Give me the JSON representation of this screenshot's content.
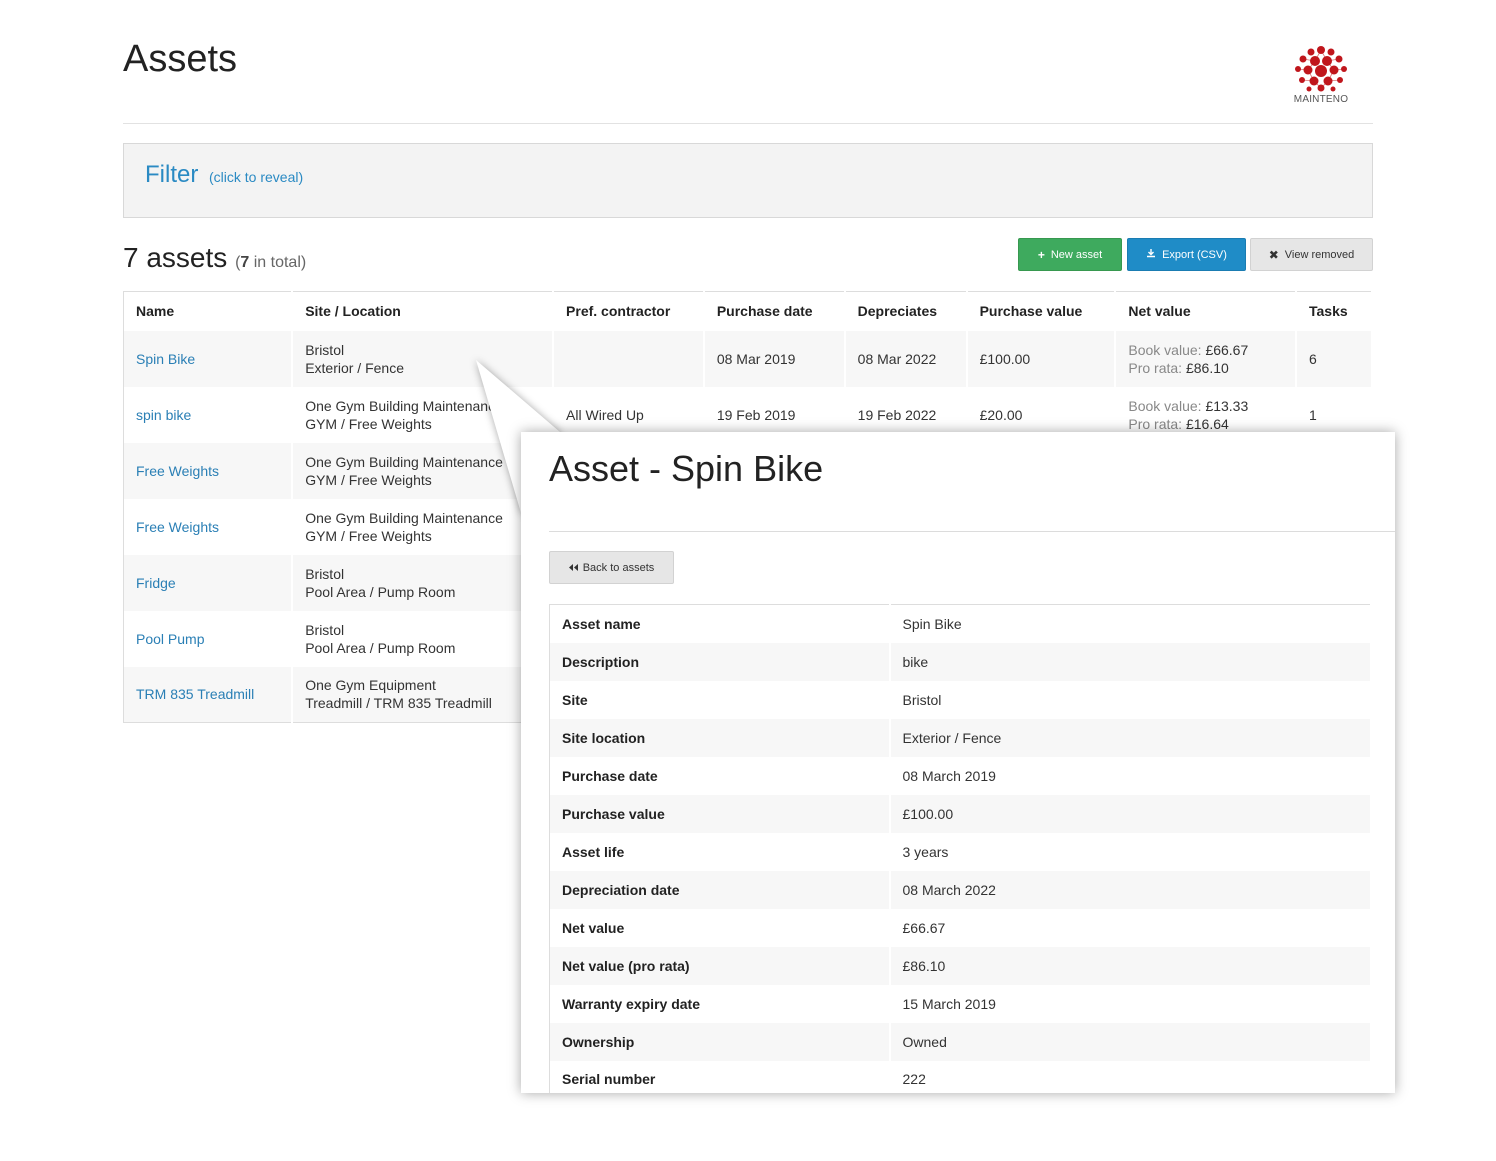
{
  "header": {
    "title": "Assets",
    "logo_text": "MAINTENO"
  },
  "filter": {
    "title": "Filter",
    "hint": "(click to reveal)"
  },
  "summary": {
    "count_label": "7 assets",
    "total_open": "(",
    "total_num": "7",
    "total_close": " in total)"
  },
  "toolbar": {
    "new_asset": "New asset",
    "export_csv": "Export (CSV)",
    "view_removed": "View removed",
    "icons": {
      "new": "plus-icon",
      "export": "download-icon",
      "removed": "x-icon"
    }
  },
  "table": {
    "headers": [
      "Name",
      "Site / Location",
      "Pref. contractor",
      "Purchase date",
      "Depreciates",
      "Purchase value",
      "Net value",
      "Tasks"
    ],
    "rows": [
      {
        "name": "Spin Bike",
        "site": "Bristol",
        "location": "Exterior / Fence",
        "contractor": "",
        "purchase_date": "08 Mar 2019",
        "depreciates": "08 Mar 2022",
        "purchase_value": "£100.00",
        "book_label": "Book value:",
        "book_value": "£66.67",
        "prorata_label": "Pro rata:",
        "prorata_value": "£86.10",
        "tasks": "6"
      },
      {
        "name": "spin bike",
        "site": "One Gym Building Maintenance",
        "location": "GYM / Free Weights",
        "contractor": "All Wired Up",
        "purchase_date": "19 Feb 2019",
        "depreciates": "19 Feb 2022",
        "purchase_value": "£20.00",
        "book_label": "Book value:",
        "book_value": "£13.33",
        "prorata_label": "Pro rata:",
        "prorata_value": "£16.64",
        "tasks": "1"
      },
      {
        "name": "Free Weights",
        "site": "One Gym Building Maintenance",
        "location": "GYM / Free Weights"
      },
      {
        "name": "Free Weights",
        "site": "One Gym Building Maintenance",
        "location": "GYM / Free Weights"
      },
      {
        "name": "Fridge",
        "site": "Bristol",
        "location": "Pool Area / Pump Room"
      },
      {
        "name": "Pool Pump",
        "site": "Bristol",
        "location": "Pool Area / Pump Room"
      },
      {
        "name": "TRM 835 Treadmill",
        "site": "One Gym Equipment",
        "location": "Treadmill / TRM 835 Treadmill"
      }
    ]
  },
  "detail": {
    "title": "Asset - Spin Bike",
    "back_label": "Back to assets",
    "back_icon": "rewind-icon",
    "fields": [
      {
        "label": "Asset name",
        "value": "Spin Bike"
      },
      {
        "label": "Description",
        "value": "bike"
      },
      {
        "label": "Site",
        "value": "Bristol"
      },
      {
        "label": "Site location",
        "value": "Exterior / Fence"
      },
      {
        "label": "Purchase date",
        "value": "08 March 2019"
      },
      {
        "label": "Purchase value",
        "value": "£100.00"
      },
      {
        "label": "Asset life",
        "value": "3 years"
      },
      {
        "label": "Depreciation date",
        "value": "08 March 2022"
      },
      {
        "label": "Net value",
        "value": "£66.67"
      },
      {
        "label": "Net value (pro rata)",
        "value": "£86.10"
      },
      {
        "label": "Warranty expiry date",
        "value": "15 March 2019"
      },
      {
        "label": "Ownership",
        "value": "Owned"
      },
      {
        "label": "Serial number",
        "value": "222"
      }
    ]
  },
  "colors": {
    "link": "#2a7fb5",
    "success": "#3eaa5e",
    "primary": "#1f8cc7",
    "logo_red": "#c0161c"
  }
}
